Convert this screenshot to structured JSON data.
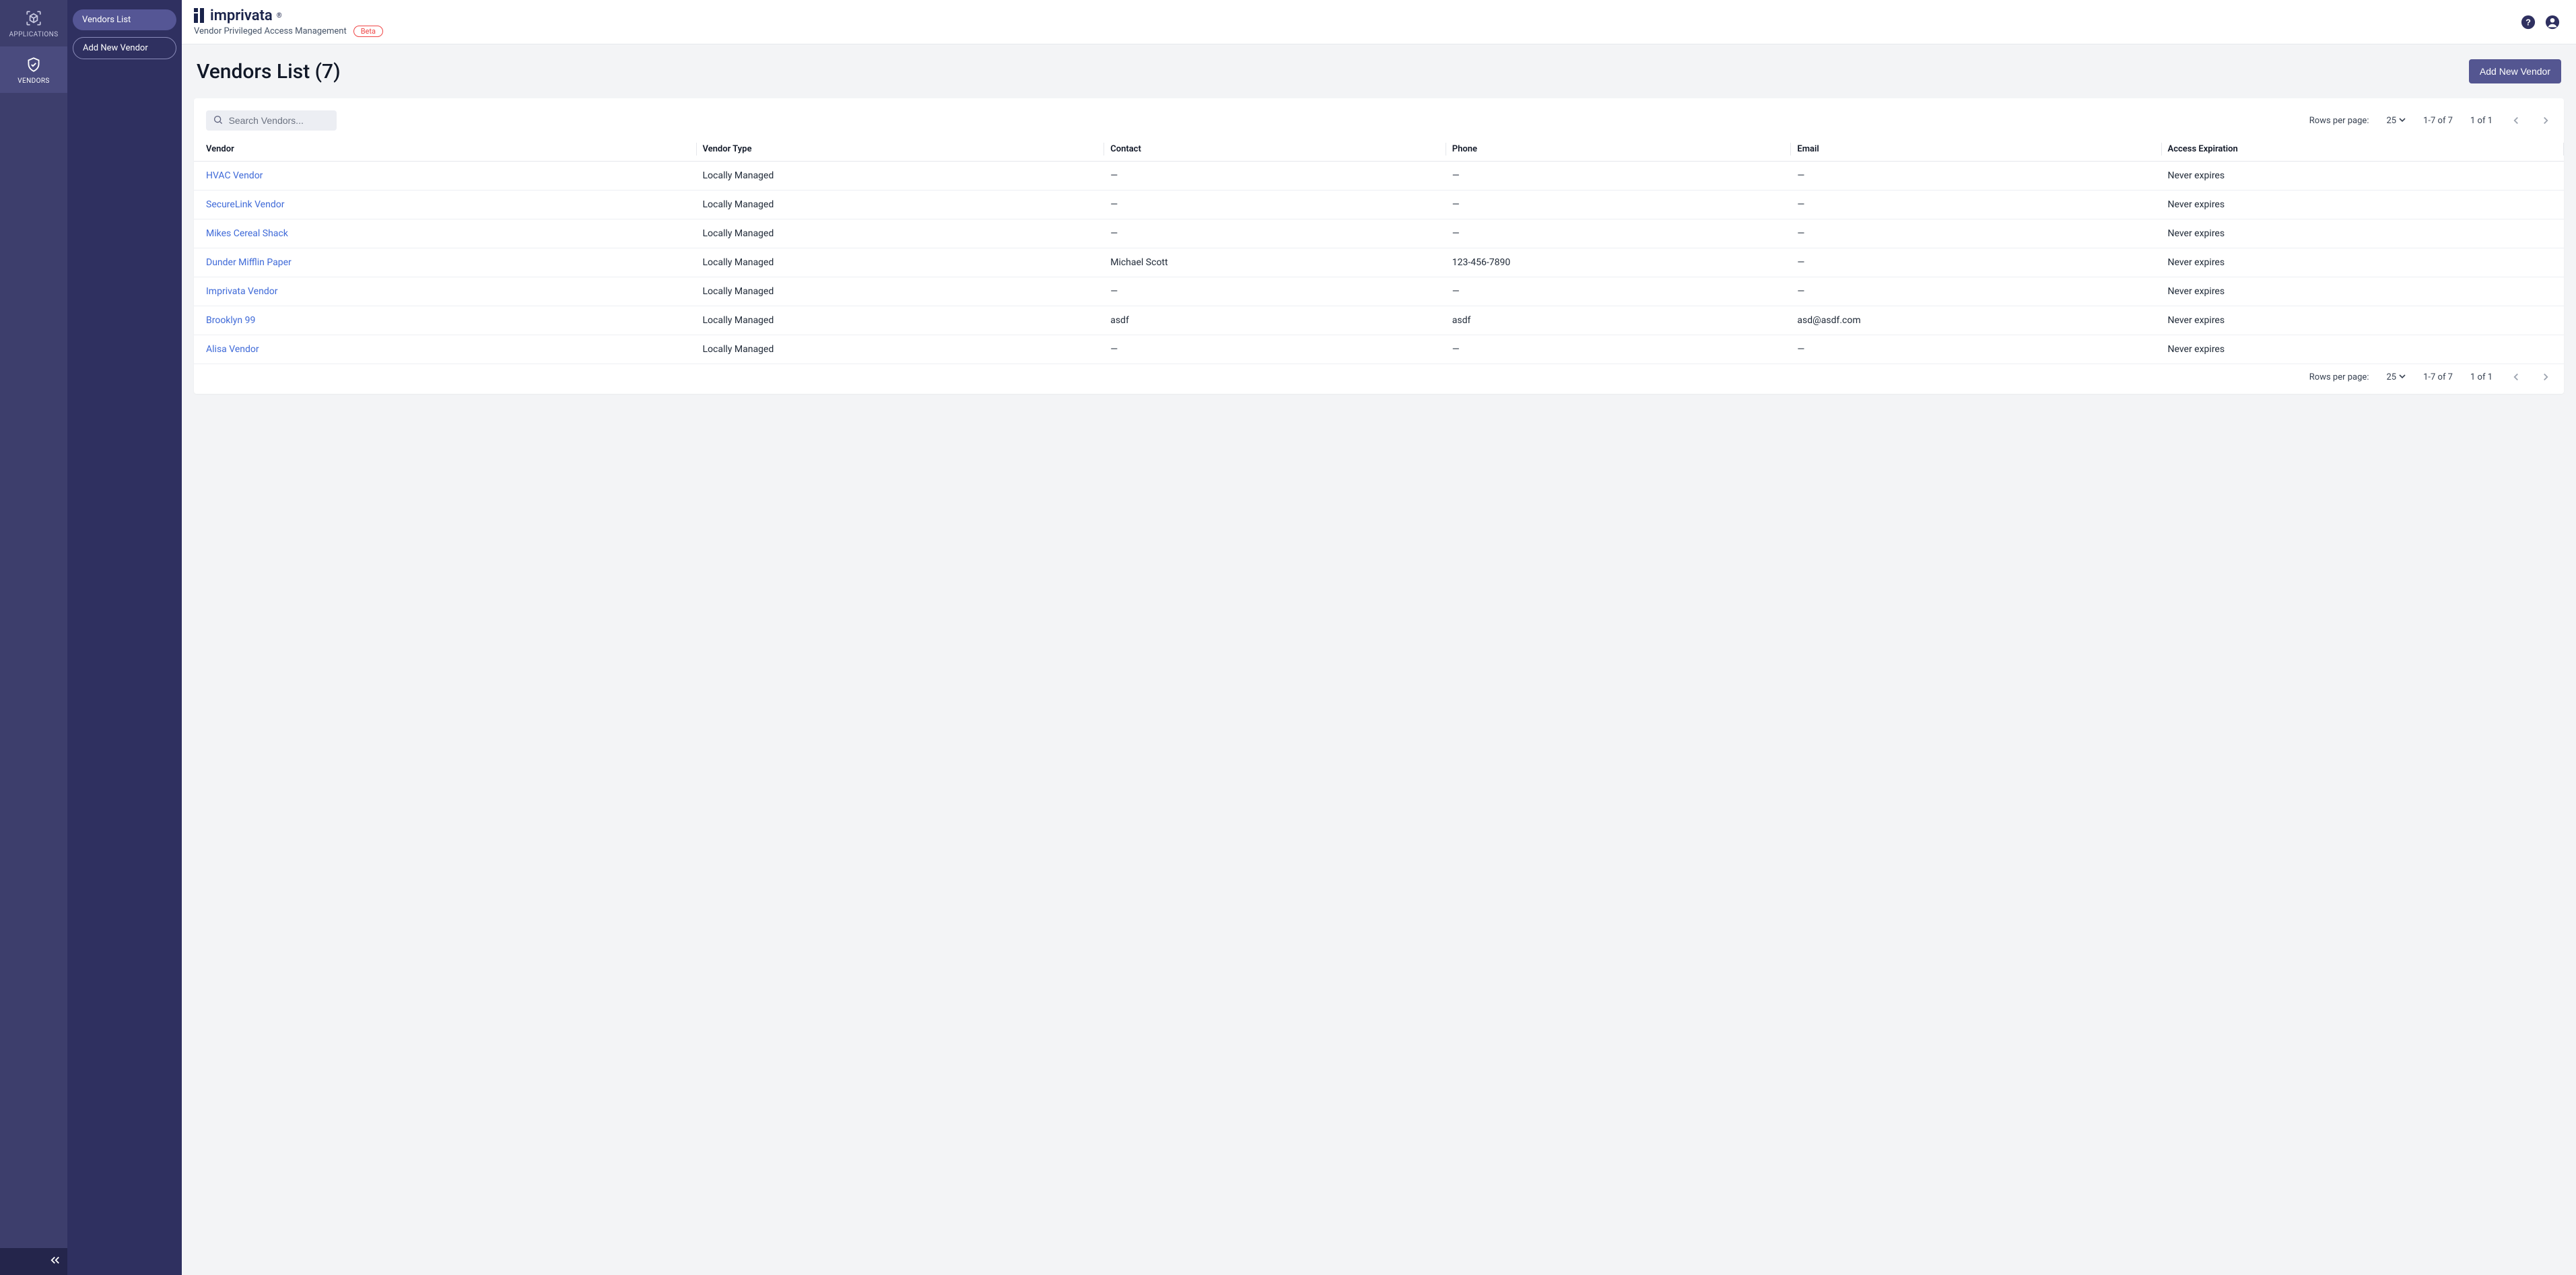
{
  "brand": {
    "name": "imprivata",
    "subtitle": "Vendor Privileged Access Management",
    "badge": "Beta"
  },
  "nav_rail": {
    "items": [
      {
        "label": "APPLICATIONS",
        "icon": "cube-scan-icon",
        "active": false
      },
      {
        "label": "VENDORS",
        "icon": "shield-check-icon",
        "active": true
      }
    ]
  },
  "sidebar": {
    "items": [
      {
        "label": "Vendors List",
        "active": true
      },
      {
        "label": "Add New Vendor",
        "active": false
      }
    ]
  },
  "page": {
    "title": "Vendors List (7)",
    "primary_button": "Add New Vendor"
  },
  "search": {
    "placeholder": "Search Vendors..."
  },
  "pagination": {
    "rows_per_page_label": "Rows per page:",
    "rows_per_page_value": "25",
    "range_text": "1-7 of 7",
    "page_text": "1 of 1"
  },
  "table": {
    "columns": [
      "Vendor",
      "Vendor Type",
      "Contact",
      "Phone",
      "Email",
      "Access Expiration"
    ],
    "rows": [
      {
        "vendor": "HVAC Vendor",
        "type": "Locally Managed",
        "contact": "—",
        "phone": "—",
        "email": "—",
        "expires": "Never expires"
      },
      {
        "vendor": "SecureLink Vendor",
        "type": "Locally Managed",
        "contact": "—",
        "phone": "—",
        "email": "—",
        "expires": "Never expires"
      },
      {
        "vendor": "Mikes Cereal Shack",
        "type": "Locally Managed",
        "contact": "—",
        "phone": "—",
        "email": "—",
        "expires": "Never expires"
      },
      {
        "vendor": "Dunder Mifflin Paper",
        "type": "Locally Managed",
        "contact": "Michael Scott",
        "phone": "123-456-7890",
        "email": "—",
        "expires": "Never expires"
      },
      {
        "vendor": "Imprivata Vendor",
        "type": "Locally Managed",
        "contact": "—",
        "phone": "—",
        "email": "—",
        "expires": "Never expires"
      },
      {
        "vendor": "Brooklyn 99",
        "type": "Locally Managed",
        "contact": "asdf",
        "phone": "asdf",
        "email": "asd@asdf.com",
        "expires": "Never expires"
      },
      {
        "vendor": "Alisa Vendor",
        "type": "Locally Managed",
        "contact": "—",
        "phone": "—",
        "email": "—",
        "expires": "Never expires"
      }
    ]
  }
}
